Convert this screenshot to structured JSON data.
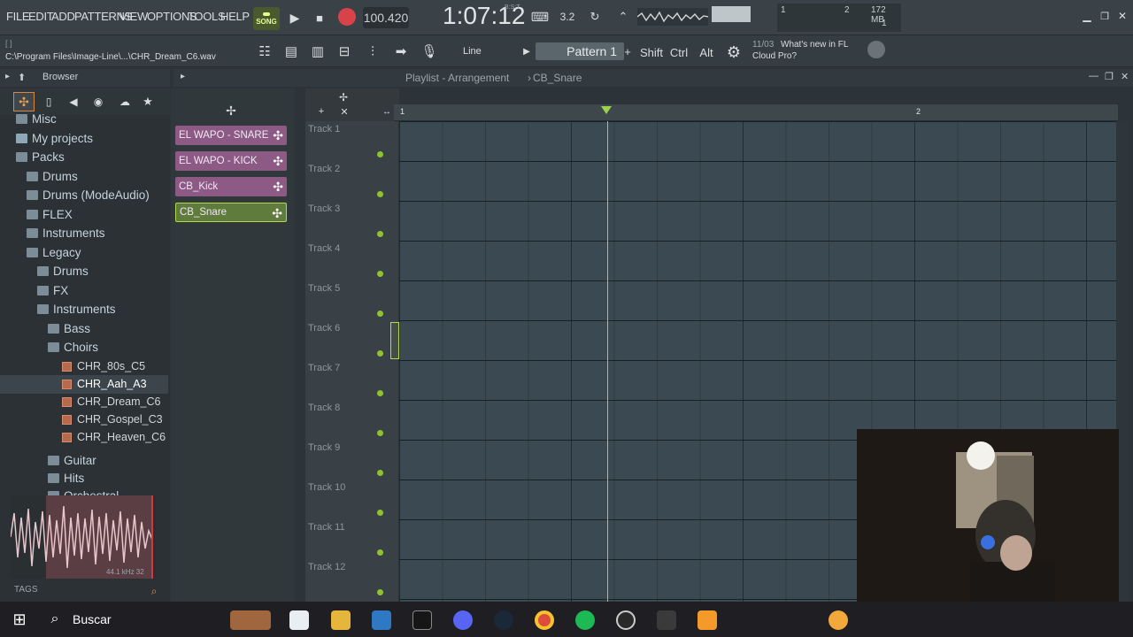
{
  "menu": {
    "file": "FILE",
    "edit": "EDIT",
    "add": "ADD",
    "patterns": "PATTERNS",
    "view": "VIEW",
    "options": "OPTIONS",
    "tools": "TOOLS",
    "help": "HELP"
  },
  "transport": {
    "mode": "SONG",
    "tempo": "100.420",
    "time": "1:07:12",
    "time_sub": "B:S:T",
    "step": "3.2",
    "snap": "Line",
    "pattern": "Pattern 1"
  },
  "meters": {
    "left": "1",
    "right": "2",
    "memory": "172 MB",
    "voices": "1"
  },
  "keys": {
    "shift": "Shift",
    "ctrl": "Ctrl",
    "alt": "Alt"
  },
  "news": {
    "date": "11/03",
    "title": "What's new in FL",
    "subtitle": "Cloud Pro?"
  },
  "hint": {
    "line1": "[ ]",
    "path": "C:\\Program Files\\Image-Line\\...\\CHR_Dream_C6.wav"
  },
  "browser": {
    "title": "Browser",
    "items": [
      {
        "label": "Misc",
        "type": "folder",
        "indent": 1
      },
      {
        "label": "My projects",
        "type": "special",
        "indent": 1
      },
      {
        "label": "Packs",
        "type": "folder",
        "indent": 1
      },
      {
        "label": "Drums",
        "type": "folder",
        "indent": 2
      },
      {
        "label": "Drums (ModeAudio)",
        "type": "folder",
        "indent": 2
      },
      {
        "label": "FLEX",
        "type": "folder",
        "indent": 2
      },
      {
        "label": "Instruments",
        "type": "folder",
        "indent": 2
      },
      {
        "label": "Legacy",
        "type": "folder",
        "indent": 2
      },
      {
        "label": "Drums",
        "type": "folder",
        "indent": 3
      },
      {
        "label": "FX",
        "type": "folder",
        "indent": 3
      },
      {
        "label": "Instruments",
        "type": "folder",
        "indent": 3
      },
      {
        "label": "Bass",
        "type": "folder",
        "indent": 4
      },
      {
        "label": "Choirs",
        "type": "folder",
        "indent": 4
      },
      {
        "label": "CHR_80s_C5",
        "type": "file",
        "indent": 5
      },
      {
        "label": "CHR_Aah_A3",
        "type": "file",
        "indent": 5
      },
      {
        "label": "CHR_Dream_C6",
        "type": "file",
        "indent": 5
      },
      {
        "label": "CHR_Gospel_C3",
        "type": "file",
        "indent": 5
      },
      {
        "label": "CHR_Heaven_C6",
        "type": "file",
        "indent": 5
      },
      {
        "label": "Guitar",
        "type": "folder",
        "indent": 4
      },
      {
        "label": "Hits",
        "type": "folder",
        "indent": 4
      },
      {
        "label": "Orchestral",
        "type": "folder",
        "indent": 4
      }
    ],
    "preview_info": "44.1 kHz 32",
    "tags": "TAGS"
  },
  "playlist": {
    "title": "Playlist - Arrangement",
    "pattern": "CB_Snare",
    "bar1": "1",
    "bar2": "2"
  },
  "channels": [
    {
      "label": "EL WAPO - SNARE",
      "color": "#8d5a86"
    },
    {
      "label": "EL WAPO - KICK",
      "color": "#8d5a86"
    },
    {
      "label": "CB_Kick",
      "color": "#8d5a86"
    },
    {
      "label": "CB_Snare",
      "color": "#5f7c3c"
    }
  ],
  "tracks": [
    "Track 1",
    "Track 2",
    "Track 3",
    "Track 4",
    "Track 5",
    "Track 6",
    "Track 7",
    "Track 8",
    "Track 9",
    "Track 10",
    "Track 11",
    "Track 12"
  ],
  "taskbar": {
    "search": "Buscar"
  }
}
